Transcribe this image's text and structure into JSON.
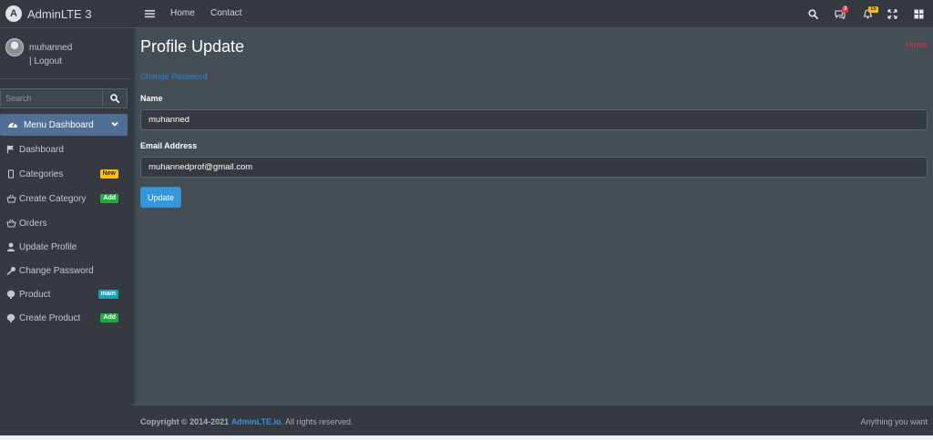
{
  "brand": {
    "name": "AdminLTE 3",
    "logo_letter": "A"
  },
  "user": {
    "name": "muhanned",
    "logout": "| Logout"
  },
  "sidebar_search": {
    "placeholder": "Search"
  },
  "sidebar": {
    "active_menu": "Menu Dashboard",
    "items": [
      {
        "label": "Dashboard",
        "icon": "flag-icon",
        "badge": null
      },
      {
        "label": "Categories",
        "icon": "mobile-icon",
        "badge": {
          "text": "New",
          "color": "#ffc107"
        }
      },
      {
        "label": "Create Category",
        "icon": "basket-icon",
        "badge": {
          "text": "Add",
          "color": "#28a745"
        }
      },
      {
        "label": "Orders",
        "icon": "basket-icon",
        "badge": null
      },
      {
        "label": "Update Profile",
        "icon": "user-icon",
        "badge": null
      },
      {
        "label": "Change Password",
        "icon": "key-icon",
        "badge": null
      },
      {
        "label": "Product",
        "icon": "brain-icon",
        "badge": {
          "text": "main",
          "color": "#17a2b8"
        }
      },
      {
        "label": "Create Product",
        "icon": "brain-icon",
        "badge": {
          "text": "Add",
          "color": "#28a745"
        }
      }
    ]
  },
  "topnav": {
    "links": [
      "Home",
      "Contact"
    ],
    "messages_count": "3",
    "notifications_count": "15"
  },
  "page": {
    "title": "Profile Update",
    "breadcrumb": "Home",
    "change_password_link": "Change Password",
    "name_label": "Name",
    "name_value": "muhanned",
    "email_label": "Email Address",
    "email_value": "muhannedprof@gmail.com",
    "submit_label": "Update"
  },
  "footer": {
    "copyright": "Copyright © 2014-2021",
    "brand_link": "AdminLTE.io.",
    "rights": "All rights reserved.",
    "right_text": "Anything you want"
  },
  "colors": {
    "sidebar_bg": "#343a40",
    "content_bg": "#454d55",
    "active_menu": "#4f6f95",
    "primary_button": "#3498db",
    "breadcrumb": "#dc3545",
    "link": "#2c7fd8"
  }
}
